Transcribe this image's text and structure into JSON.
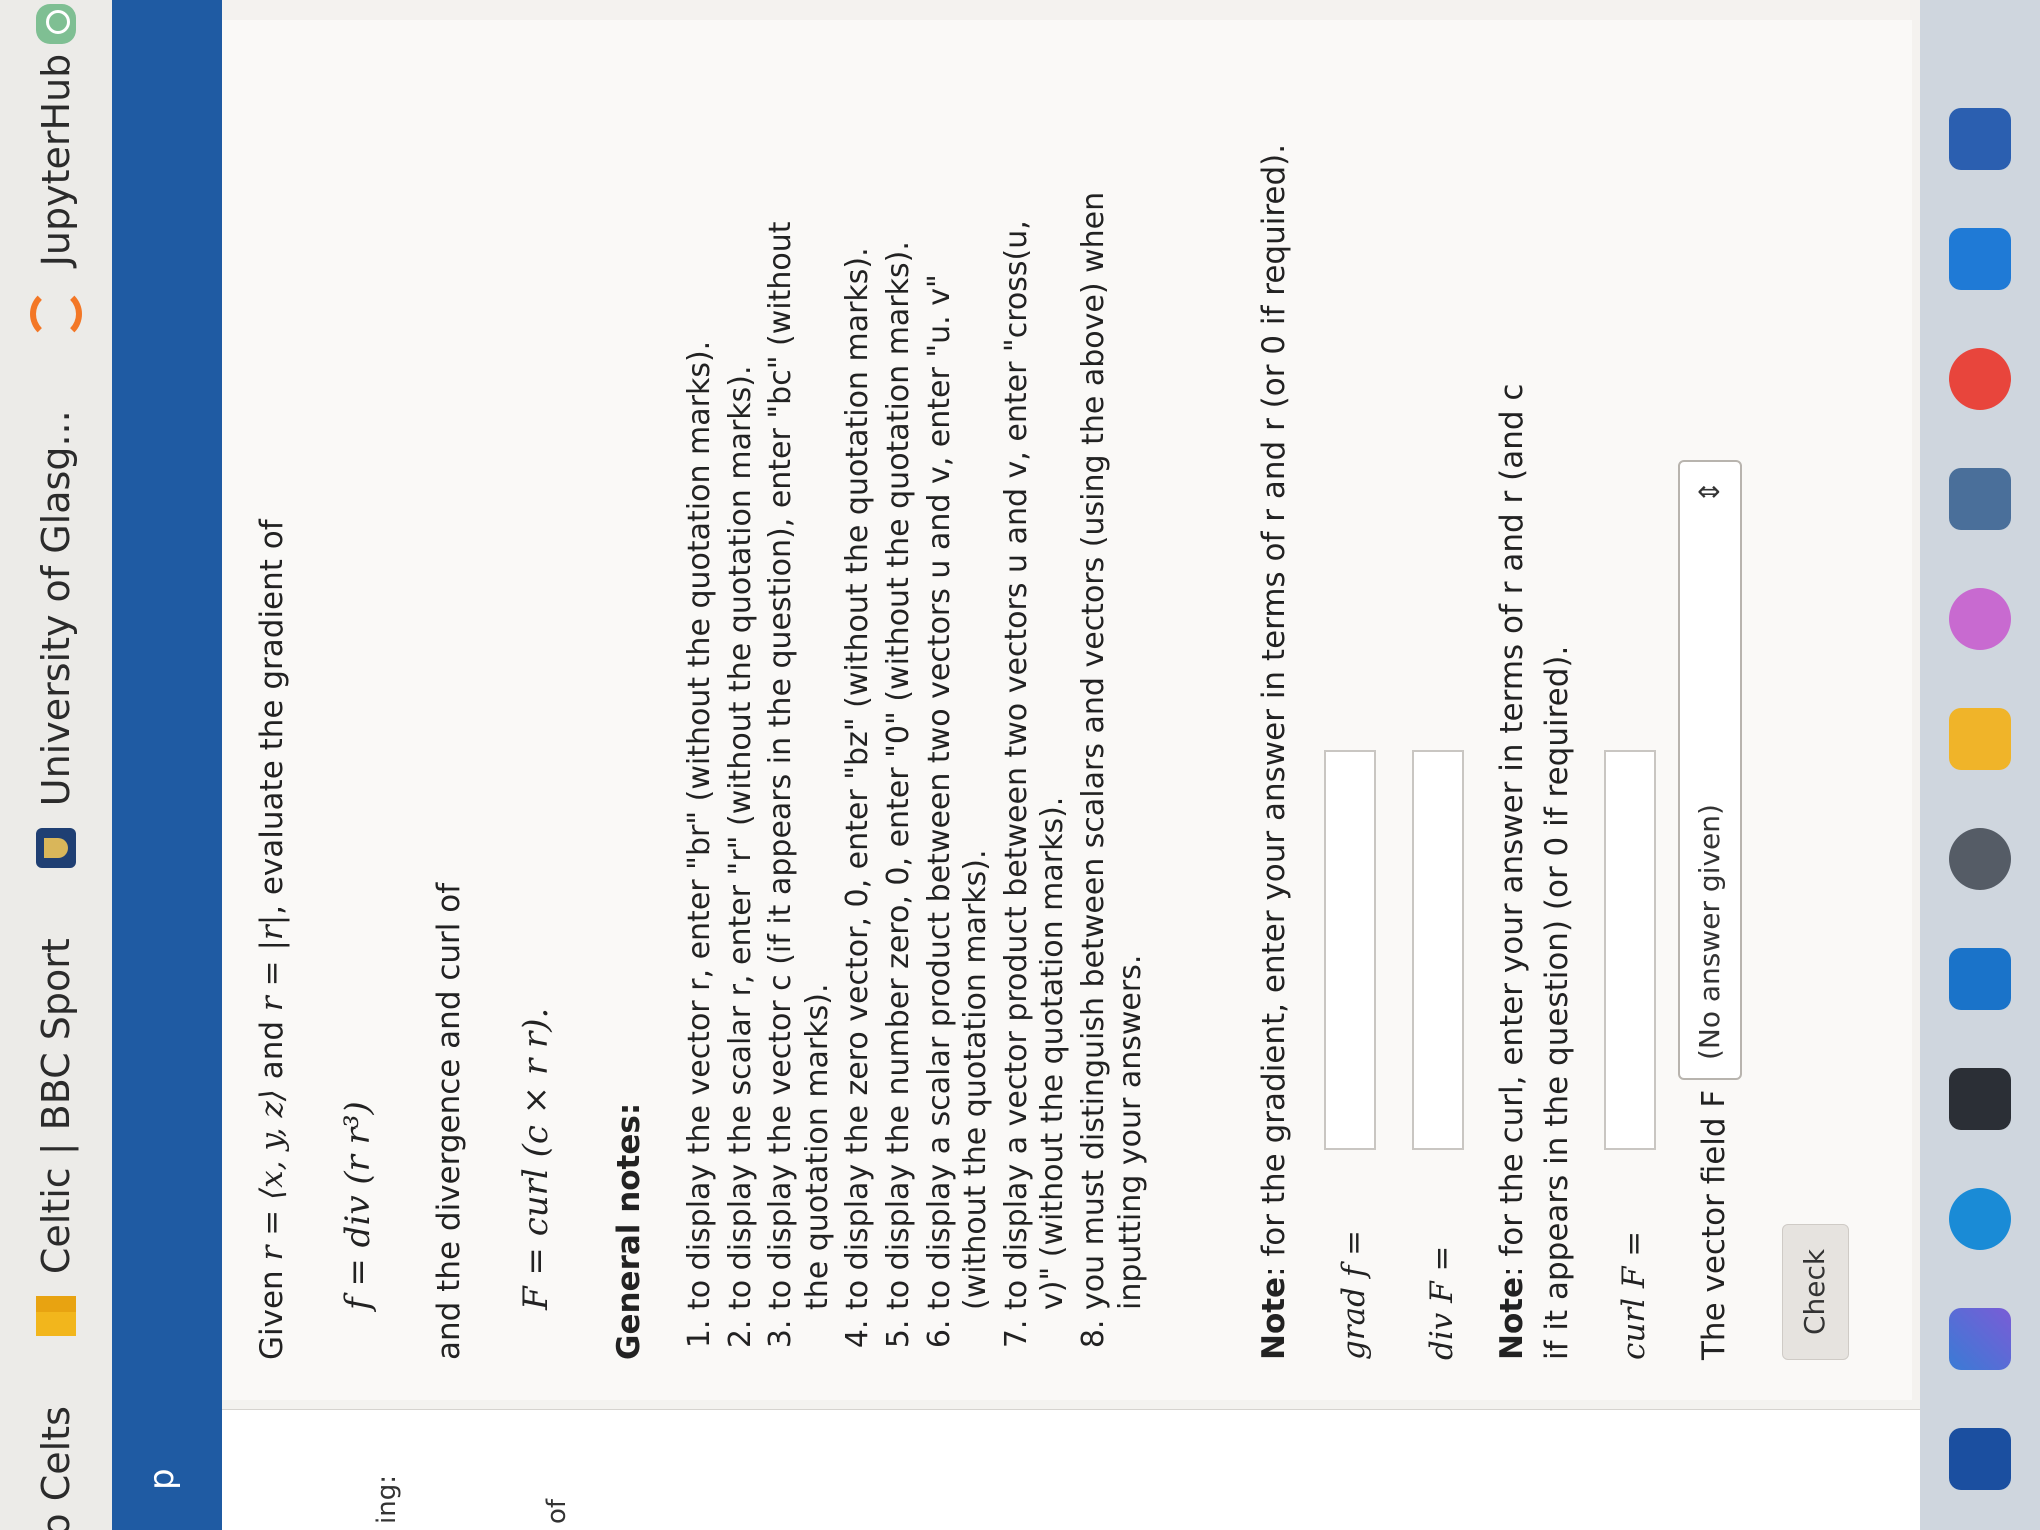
{
  "bookmarks": {
    "items": [
      {
        "label": "eo Celts"
      },
      {
        "label": "Celtic | BBC Sport"
      },
      {
        "label": "University of Glasg..."
      },
      {
        "label": "JupyterHub"
      }
    ]
  },
  "header": {
    "fragment": "p"
  },
  "side_labels": [
    "ing:",
    "of"
  ],
  "question": {
    "intro_given": "Given",
    "intro_math": "r = ⟨x, y, z⟩",
    "intro_and": "and",
    "intro_math2": "r = |r|",
    "intro_tail": ", evaluate the gradient of",
    "f_def": "f = div (r r³)",
    "divcurl_text": "and the divergence and curl of",
    "F_def": "F = curl (c × r r).",
    "general_notes_title": "General notes:",
    "notes": [
      "to display the vector r, enter \"br\" (without the quotation marks).",
      "to display the scalar r, enter \"r\" (without the quotation marks).",
      "to display the vector c (if it appears in the question), enter \"bc\" (without the quotation marks).",
      "to display the zero vector, 0, enter \"bz\" (without the quotation marks).",
      "to display the number zero, 0, enter \"0\" (without the quotation marks).",
      "to display a scalar product between two vectors u and v, enter \"u. v\" (without the quotation marks).",
      "to display a vector product between two vectors u and v, enter \"cross(u, v)\" (without the quotation marks).",
      "you must distinguish between scalars and vectors (using the above) when inputting your answers."
    ],
    "note_grad_bold": "Note",
    "note_grad": ": for the gradient, enter your answer in terms of r and r (or 0 if required).",
    "grad_label": "grad f =",
    "div_label": "div F =",
    "note_curl_bold": "Note",
    "note_curl": ": for the curl, enter your answer in terms of r and r (and c if it appears in the question) (or 0 if required).",
    "curl_label": "curl F =",
    "field_label": "The vector field F is",
    "field_select": "(No answer given)",
    "check_label": "Check"
  }
}
